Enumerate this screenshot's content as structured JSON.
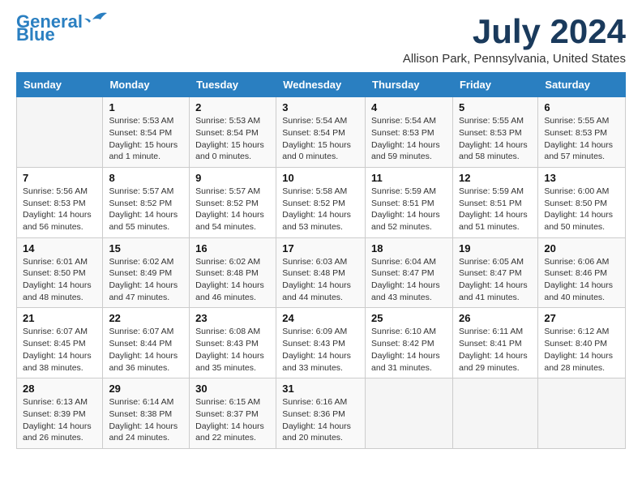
{
  "logo": {
    "line1": "General",
    "line2": "Blue"
  },
  "title": "July 2024",
  "location": "Allison Park, Pennsylvania, United States",
  "days_of_week": [
    "Sunday",
    "Monday",
    "Tuesday",
    "Wednesday",
    "Thursday",
    "Friday",
    "Saturday"
  ],
  "weeks": [
    [
      {
        "day": "",
        "info": ""
      },
      {
        "day": "1",
        "info": "Sunrise: 5:53 AM\nSunset: 8:54 PM\nDaylight: 15 hours\nand 1 minute."
      },
      {
        "day": "2",
        "info": "Sunrise: 5:53 AM\nSunset: 8:54 PM\nDaylight: 15 hours\nand 0 minutes."
      },
      {
        "day": "3",
        "info": "Sunrise: 5:54 AM\nSunset: 8:54 PM\nDaylight: 15 hours\nand 0 minutes."
      },
      {
        "day": "4",
        "info": "Sunrise: 5:54 AM\nSunset: 8:53 PM\nDaylight: 14 hours\nand 59 minutes."
      },
      {
        "day": "5",
        "info": "Sunrise: 5:55 AM\nSunset: 8:53 PM\nDaylight: 14 hours\nand 58 minutes."
      },
      {
        "day": "6",
        "info": "Sunrise: 5:55 AM\nSunset: 8:53 PM\nDaylight: 14 hours\nand 57 minutes."
      }
    ],
    [
      {
        "day": "7",
        "info": "Sunrise: 5:56 AM\nSunset: 8:53 PM\nDaylight: 14 hours\nand 56 minutes."
      },
      {
        "day": "8",
        "info": "Sunrise: 5:57 AM\nSunset: 8:52 PM\nDaylight: 14 hours\nand 55 minutes."
      },
      {
        "day": "9",
        "info": "Sunrise: 5:57 AM\nSunset: 8:52 PM\nDaylight: 14 hours\nand 54 minutes."
      },
      {
        "day": "10",
        "info": "Sunrise: 5:58 AM\nSunset: 8:52 PM\nDaylight: 14 hours\nand 53 minutes."
      },
      {
        "day": "11",
        "info": "Sunrise: 5:59 AM\nSunset: 8:51 PM\nDaylight: 14 hours\nand 52 minutes."
      },
      {
        "day": "12",
        "info": "Sunrise: 5:59 AM\nSunset: 8:51 PM\nDaylight: 14 hours\nand 51 minutes."
      },
      {
        "day": "13",
        "info": "Sunrise: 6:00 AM\nSunset: 8:50 PM\nDaylight: 14 hours\nand 50 minutes."
      }
    ],
    [
      {
        "day": "14",
        "info": "Sunrise: 6:01 AM\nSunset: 8:50 PM\nDaylight: 14 hours\nand 48 minutes."
      },
      {
        "day": "15",
        "info": "Sunrise: 6:02 AM\nSunset: 8:49 PM\nDaylight: 14 hours\nand 47 minutes."
      },
      {
        "day": "16",
        "info": "Sunrise: 6:02 AM\nSunset: 8:48 PM\nDaylight: 14 hours\nand 46 minutes."
      },
      {
        "day": "17",
        "info": "Sunrise: 6:03 AM\nSunset: 8:48 PM\nDaylight: 14 hours\nand 44 minutes."
      },
      {
        "day": "18",
        "info": "Sunrise: 6:04 AM\nSunset: 8:47 PM\nDaylight: 14 hours\nand 43 minutes."
      },
      {
        "day": "19",
        "info": "Sunrise: 6:05 AM\nSunset: 8:47 PM\nDaylight: 14 hours\nand 41 minutes."
      },
      {
        "day": "20",
        "info": "Sunrise: 6:06 AM\nSunset: 8:46 PM\nDaylight: 14 hours\nand 40 minutes."
      }
    ],
    [
      {
        "day": "21",
        "info": "Sunrise: 6:07 AM\nSunset: 8:45 PM\nDaylight: 14 hours\nand 38 minutes."
      },
      {
        "day": "22",
        "info": "Sunrise: 6:07 AM\nSunset: 8:44 PM\nDaylight: 14 hours\nand 36 minutes."
      },
      {
        "day": "23",
        "info": "Sunrise: 6:08 AM\nSunset: 8:43 PM\nDaylight: 14 hours\nand 35 minutes."
      },
      {
        "day": "24",
        "info": "Sunrise: 6:09 AM\nSunset: 8:43 PM\nDaylight: 14 hours\nand 33 minutes."
      },
      {
        "day": "25",
        "info": "Sunrise: 6:10 AM\nSunset: 8:42 PM\nDaylight: 14 hours\nand 31 minutes."
      },
      {
        "day": "26",
        "info": "Sunrise: 6:11 AM\nSunset: 8:41 PM\nDaylight: 14 hours\nand 29 minutes."
      },
      {
        "day": "27",
        "info": "Sunrise: 6:12 AM\nSunset: 8:40 PM\nDaylight: 14 hours\nand 28 minutes."
      }
    ],
    [
      {
        "day": "28",
        "info": "Sunrise: 6:13 AM\nSunset: 8:39 PM\nDaylight: 14 hours\nand 26 minutes."
      },
      {
        "day": "29",
        "info": "Sunrise: 6:14 AM\nSunset: 8:38 PM\nDaylight: 14 hours\nand 24 minutes."
      },
      {
        "day": "30",
        "info": "Sunrise: 6:15 AM\nSunset: 8:37 PM\nDaylight: 14 hours\nand 22 minutes."
      },
      {
        "day": "31",
        "info": "Sunrise: 6:16 AM\nSunset: 8:36 PM\nDaylight: 14 hours\nand 20 minutes."
      },
      {
        "day": "",
        "info": ""
      },
      {
        "day": "",
        "info": ""
      },
      {
        "day": "",
        "info": ""
      }
    ]
  ]
}
